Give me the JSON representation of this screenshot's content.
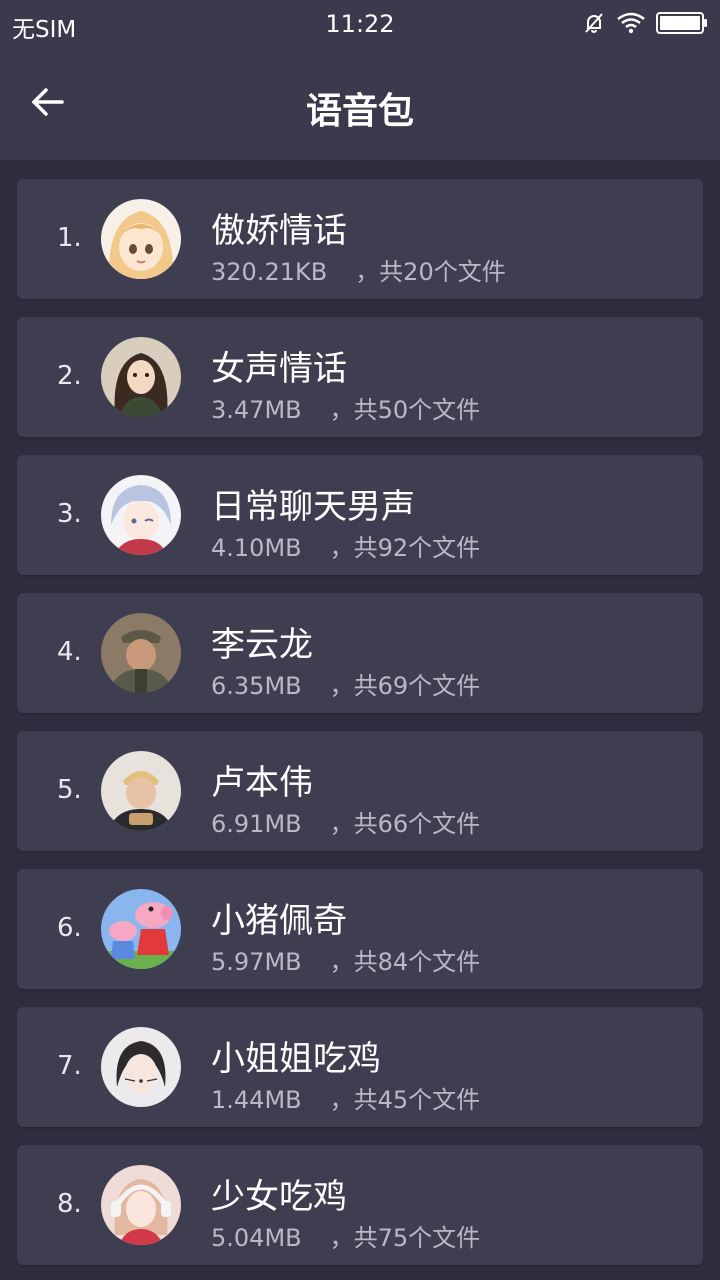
{
  "status": {
    "carrier": "无SIM",
    "time": "11:22"
  },
  "header": {
    "title": "语音包",
    "back_icon": "arrow-left-icon"
  },
  "items": [
    {
      "index": "1.",
      "name": "傲娇情话",
      "size": "320.21KB",
      "files": "，共20个文件",
      "avatar": "anime-girl-avatar",
      "avatar_color": "#f2c98a"
    },
    {
      "index": "2.",
      "name": "女声情话",
      "size": "3.47MB",
      "files": "，共50个文件",
      "avatar": "girl-photo-avatar",
      "avatar_color": "#6b5a4a"
    },
    {
      "index": "3.",
      "name": "日常聊天男声",
      "size": "4.10MB",
      "files": "，共92个文件",
      "avatar": "anime-boy-avatar",
      "avatar_color": "#b9c4e0"
    },
    {
      "index": "4.",
      "name": "李云龙",
      "size": "6.35MB",
      "files": "，共69个文件",
      "avatar": "soldier-photo-avatar",
      "avatar_color": "#6e5c48"
    },
    {
      "index": "5.",
      "name": "卢本伟",
      "size": "6.91MB",
      "files": "，共66个文件",
      "avatar": "man-photo-avatar",
      "avatar_color": "#c9a68a"
    },
    {
      "index": "6.",
      "name": "小猪佩奇",
      "size": "5.97MB",
      "files": "，共84个文件",
      "avatar": "peppa-pig-avatar",
      "avatar_color": "#8ab6f0"
    },
    {
      "index": "7.",
      "name": "小姐姐吃鸡",
      "size": "1.44MB",
      "files": "，共45个文件",
      "avatar": "cat-face-girl-avatar",
      "avatar_color": "#e9e4e6"
    },
    {
      "index": "8.",
      "name": "少女吃鸡",
      "size": "5.04MB",
      "files": "，共75个文件",
      "avatar": "headphone-girl-avatar",
      "avatar_color": "#e6b8a8"
    }
  ]
}
